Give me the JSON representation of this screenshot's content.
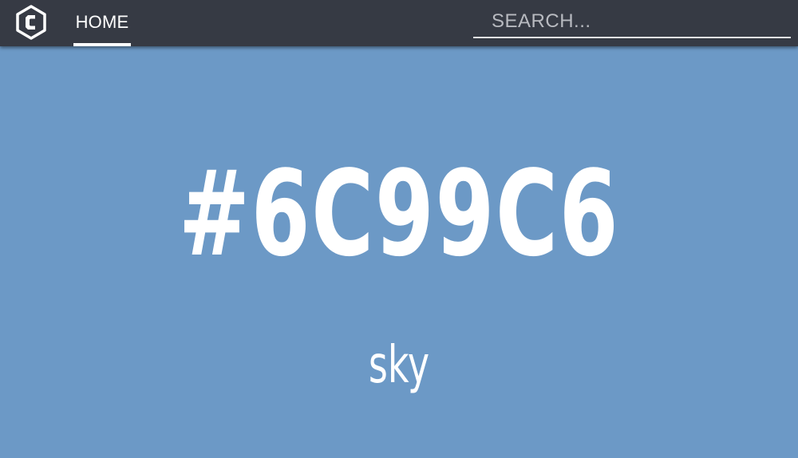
{
  "navbar": {
    "logo_icon": "hexagon-c-logo-icon",
    "home_label": "HOME",
    "search": {
      "placeholder": "SEARCH...",
      "value": ""
    }
  },
  "hero": {
    "hex_code": "#6C99C6",
    "color_name": "sky",
    "background_color": "#6C99C6"
  },
  "colors": {
    "navbar_background": "#363a44",
    "text": "#ffffff"
  }
}
